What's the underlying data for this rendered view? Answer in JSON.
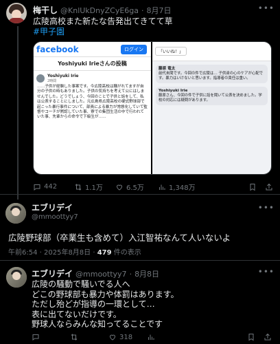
{
  "post1": {
    "name": "梅干し",
    "handle": "@KnlUkDnyZCyE6ga",
    "date": "8月7日",
    "text": "広陵高校また新たな告発出てきてて草",
    "hashtag": "#甲子園",
    "media": {
      "left": {
        "logo": "facebook",
        "login": "ログイン",
        "title": "Yoshiyuki Irieさんの投稿",
        "author": "Yoshiyuki Irie",
        "author_date": "2時間",
        "body": "……子供が経験した事案です。今広陵高校は騒がれてますが自分の子供の時もありました。子供の気持ちを考えて公にはしませんでした。どうでしょう、今回のことで子供と話をして、私は公表することにしました。元広島県広陵高校の硬式野球部で起こった暴行事件について、部員による暴力が常態化していて監督やコーチが黙認していた事、寮での集団生活の中で行われていた事、先輩からの命令で下級生が……"
      },
      "right": {
        "like": "「いいね！」",
        "comments": [
          {
            "name": "藤原 竜太",
            "text": "前代未聞です。今回の件で広陵は… 子供達の心のケアが心配です。暴力はいけないと思います。指導者の責任は重い。"
          },
          {
            "name": "Yoshiyuki Irie",
            "text": "藤原さん、今回の件で子供に話を聞いて公表を決めました。学校の対応には疑問があります。"
          }
        ]
      }
    },
    "actions": {
      "reply": "442",
      "repost": "1.1万",
      "like": "6.5万",
      "views": "1,348万"
    }
  },
  "post2": {
    "name": "エブリデイ",
    "handle": "@mmoottyy7",
    "text": "広陵野球部（卒業生も含めて）入江智祐なんて人いないよ",
    "time": "午前6:54 · 2025年8月8日 · ",
    "views_count": "479",
    "views_label": "件の表示"
  },
  "post3": {
    "name": "エブリデイ",
    "handle": "@mmoottyy7",
    "date": "8月8日",
    "lines": [
      "広陵の騒動で騒いでる人へ",
      "どこの野球部も暴力や体罰はあります。",
      "ただし殆どが指導の一環として…",
      "表に出てないだけです。",
      "野球人ならみんな知ってることです"
    ],
    "actions": {
      "reply": "",
      "repost": "",
      "like": "318",
      "views": ""
    }
  }
}
